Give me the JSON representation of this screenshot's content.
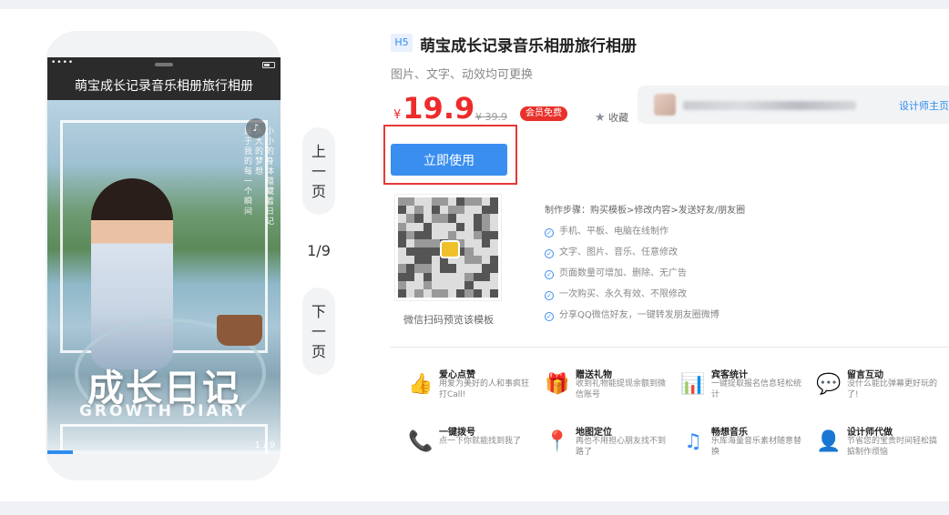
{
  "preview": {
    "title_bar": "萌宝成长记录音乐相册旅行相册",
    "status_dots": "••••",
    "vertical_text": [
      "小小的身体蕴藏着日记",
      "大大的梦想",
      "属于我的每一个瞬间"
    ],
    "big_title": "成长日记",
    "big_subtitle": "GROWTH DIARY",
    "page_counter": "1 / 9",
    "music_icon": "music-note-icon",
    "progress": 0.11
  },
  "pager": {
    "prev_label": [
      "上",
      "一",
      "页"
    ],
    "next_label": [
      "下",
      "一",
      "页"
    ],
    "indicator": "1/9"
  },
  "product": {
    "tag": "H5",
    "title": "萌宝成长记录音乐相册旅行相册",
    "subtitle": "图片、文字、动效均可更换",
    "currency": "¥",
    "price": "19.9",
    "old_price": "¥ 39.9",
    "vip_badge": "会员免费",
    "favorite_label": "收藏",
    "designer_link": "设计师主页",
    "use_button": "立即使用",
    "qr_caption": "微信扫码预览该模板"
  },
  "steps": {
    "header": "制作步骤：购买模板>修改内容>发送好友/朋友圈",
    "features": [
      "手机、平板、电脑在线制作",
      "文字、图片、音乐、任意修改",
      "页面数量可增加、删除、无广告",
      "一次购买、永久有效、不限修改",
      "分享QQ微信好友，一键转发朋友圈微博"
    ]
  },
  "features": [
    {
      "icon": "thumbs-up-icon",
      "title": "爱心点赞",
      "desc": "用爱为美好的人和事疯狂打Call!"
    },
    {
      "icon": "gift-icon",
      "title": "赠送礼物",
      "desc": "收到礼物能提现余额到微信账号"
    },
    {
      "icon": "bar-chart-icon",
      "title": "宾客统计",
      "desc": "一键提取报名信息轻松统计"
    },
    {
      "icon": "chat-bubble-icon",
      "title": "留言互动",
      "desc": "没什么能比弹幕更好玩的了!"
    },
    {
      "icon": "phone-icon",
      "title": "一键拨号",
      "desc": "点一下你就能找到我了"
    },
    {
      "icon": "location-pin-icon",
      "title": "地图定位",
      "desc": "再也不用担心朋友找不到路了"
    },
    {
      "icon": "music-icon",
      "title": "畅想音乐",
      "desc": "乐库海量音乐素材随意替换"
    },
    {
      "icon": "designer-icon",
      "title": "设计师代做",
      "desc": "节省您的宝贵时间轻松搞掂制作烦恼"
    }
  ],
  "colors": {
    "accent": "#3a8ef0",
    "price_red": "#ee2b2b",
    "highlight_box": "#e53935"
  }
}
